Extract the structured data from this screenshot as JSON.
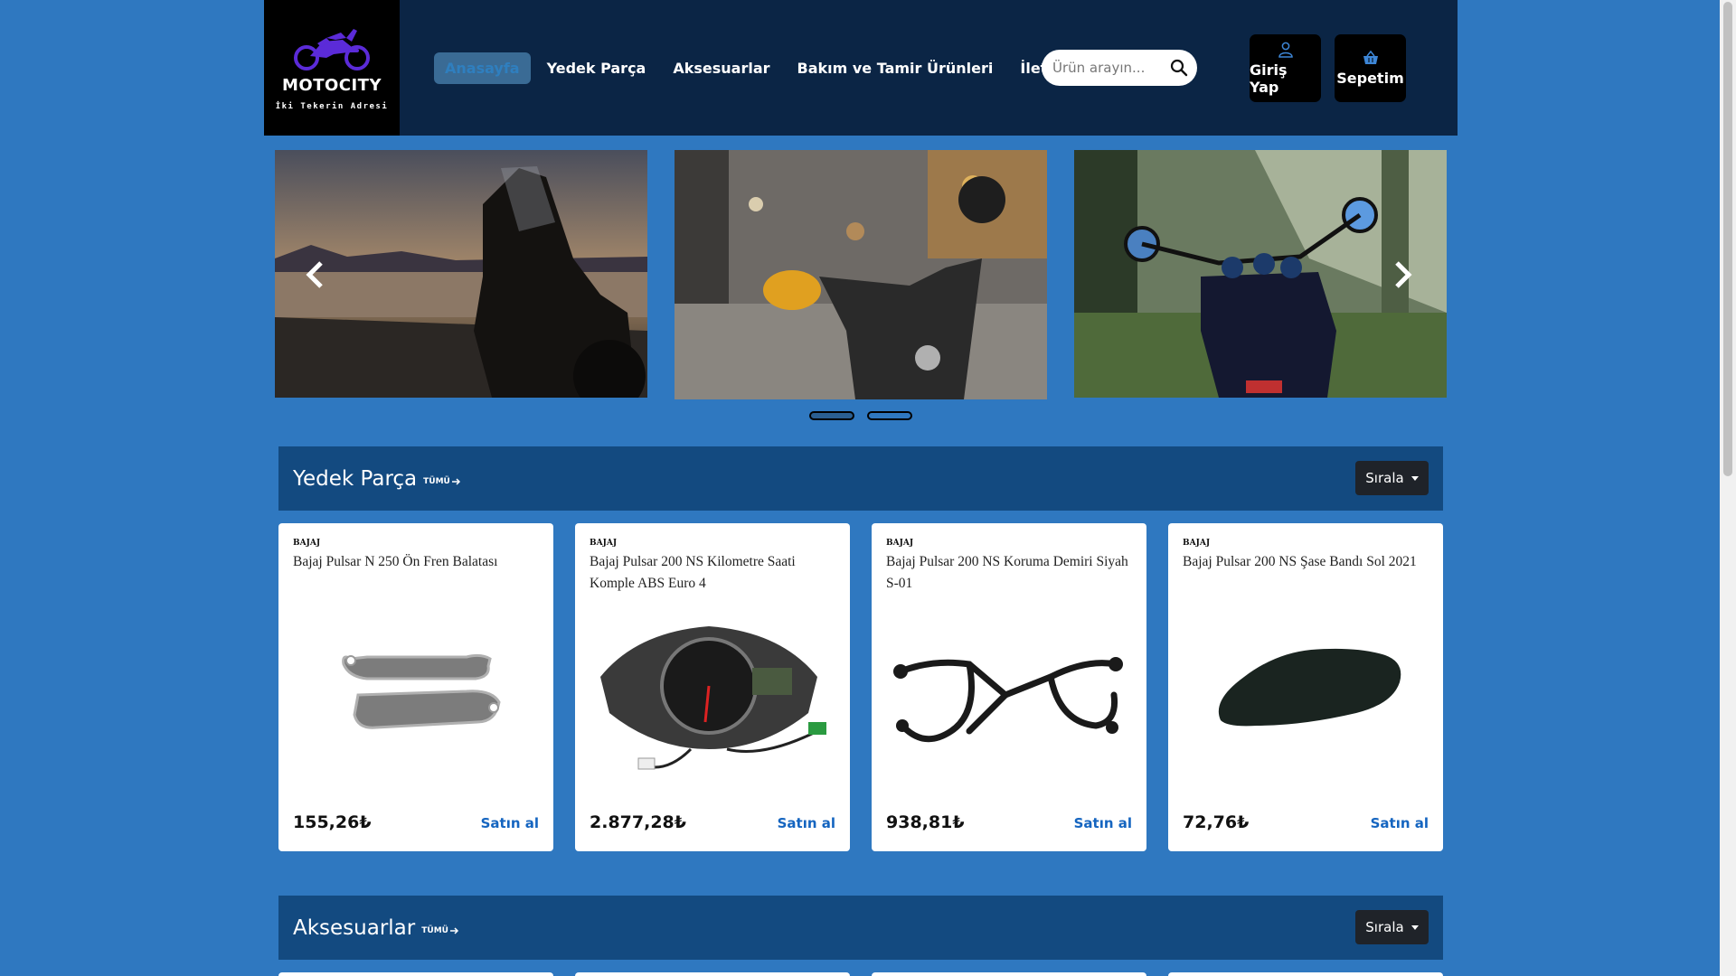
{
  "brand": {
    "title": "MOTOCITY",
    "tagline": "İki Tekerin Adresi"
  },
  "nav": {
    "items": [
      {
        "label": "Anasayfa",
        "active": true
      },
      {
        "label": "Yedek Parça"
      },
      {
        "label": "Aksesuarlar"
      },
      {
        "label": "Bakım ve Tamir Ürünleri"
      },
      {
        "label": "İletişim"
      }
    ]
  },
  "search": {
    "placeholder": "Ürün arayın..."
  },
  "header_buttons": {
    "login_label": "Giriş Yap",
    "cart_label": "Sepetim"
  },
  "carousel": {
    "slides": [
      "sunset-lake-motorcycle",
      "city-street-scooter",
      "forest-motorcycle"
    ],
    "indicators": [
      true,
      false
    ]
  },
  "sections": [
    {
      "title": "Yedek Parça",
      "all_label": "TÜMÜ",
      "sort_label": "Sırala",
      "products": [
        {
          "brand": "BAJAJ",
          "name": "Bajaj Pulsar N 250 Ön Fren Balatası",
          "price": "155,26₺",
          "buy_label": "Satın al"
        },
        {
          "brand": "BAJAJ",
          "name": "Bajaj Pulsar 200 NS Kilometre Saati Komple ABS Euro 4",
          "price": "2.877,28₺",
          "buy_label": "Satın al"
        },
        {
          "brand": "BAJAJ",
          "name": "Bajaj Pulsar 200 NS Koruma Demiri Siyah S-01",
          "price": "938,81₺",
          "buy_label": "Satın al"
        },
        {
          "brand": "BAJAJ",
          "name": "Bajaj Pulsar 200 NS Şase Bandı Sol 2021",
          "price": "72,76₺",
          "buy_label": "Satın al"
        }
      ]
    },
    {
      "title": "Aksesuarlar",
      "all_label": "TÜMÜ",
      "sort_label": "Sırala"
    }
  ],
  "icons": {
    "search": "search-icon",
    "user": "user-icon",
    "basket": "basket-icon",
    "prev": "chevron-left-icon",
    "next": "chevron-right-icon",
    "arrow": "arrow-right-icon"
  },
  "colors": {
    "page_bg": "#2f78c0",
    "header_bg": "#0b2545",
    "section_bar": "#134a80",
    "buy_link": "#1565c0",
    "logo_purple": "#5b2bd8"
  }
}
